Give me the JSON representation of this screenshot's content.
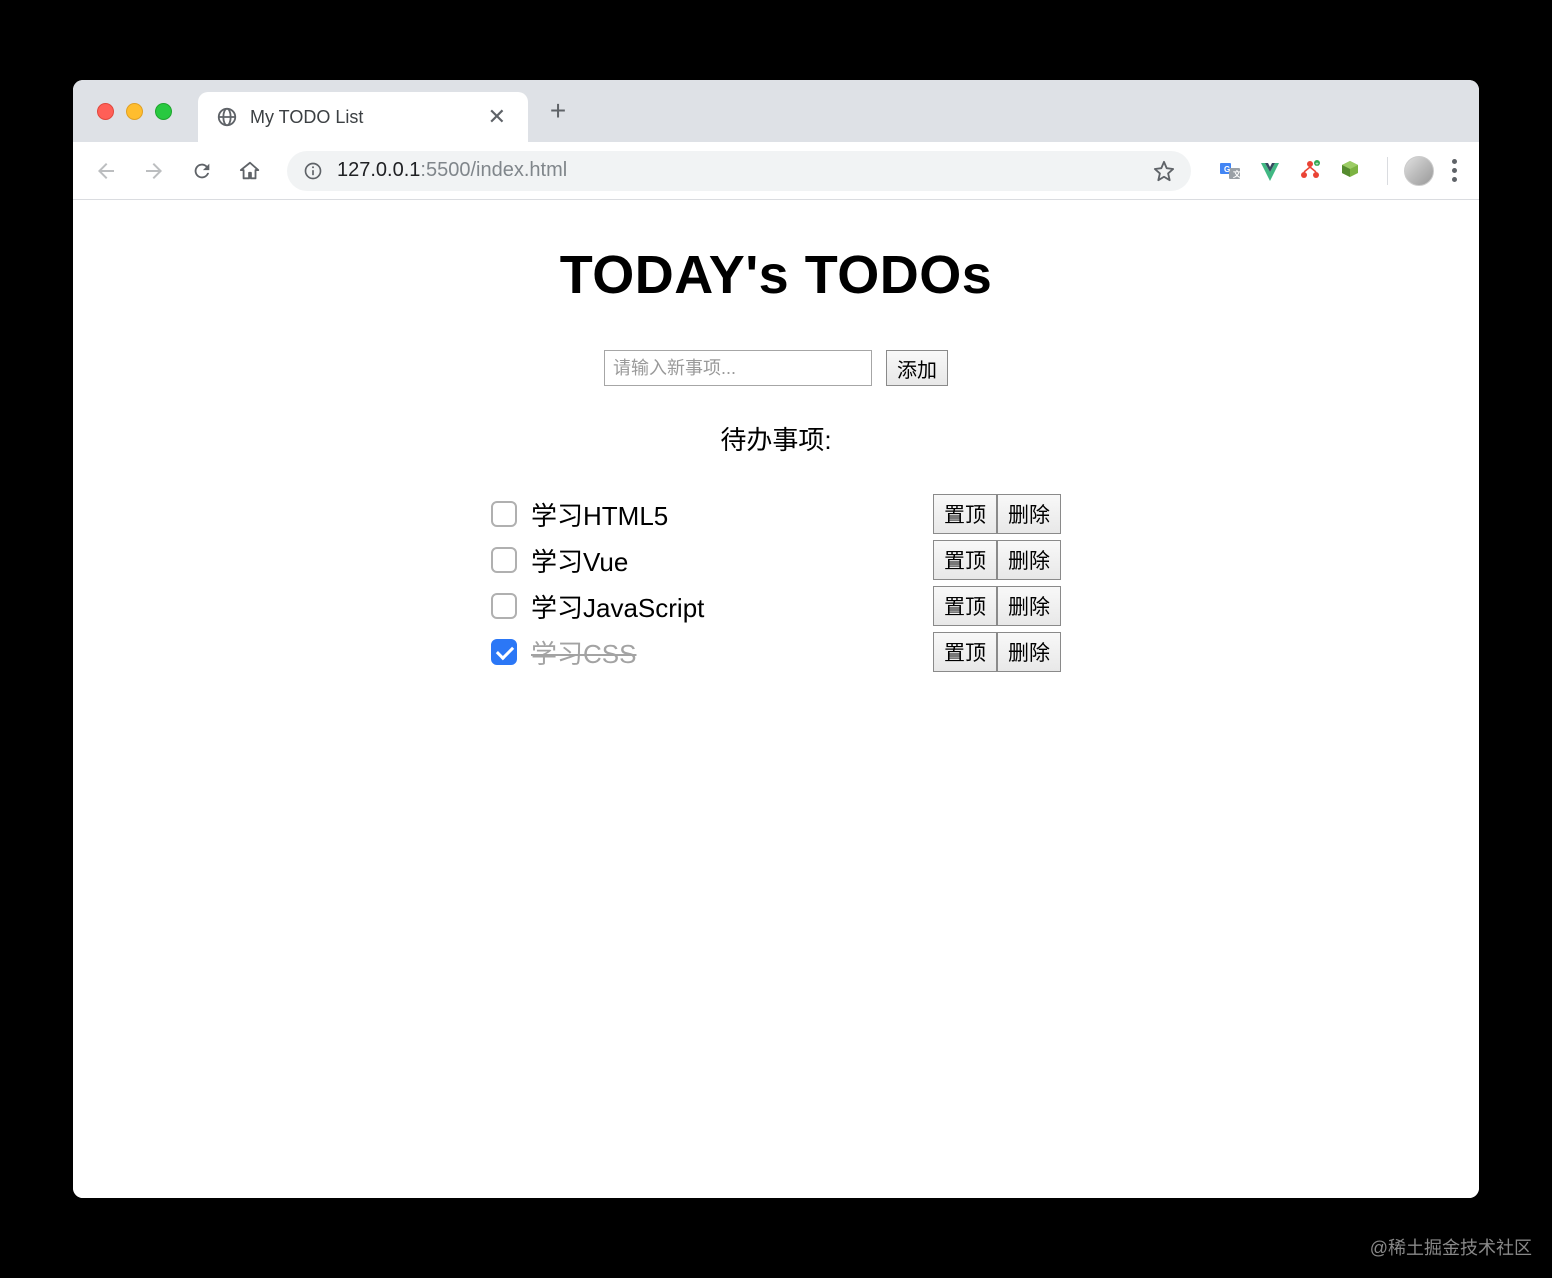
{
  "browser": {
    "tab_title": "My TODO List",
    "url_host": "127.0.0.1",
    "url_port_path": ":5500/index.html"
  },
  "page": {
    "heading": "TODAY's TODOs",
    "input_placeholder": "请输入新事项...",
    "add_button": "添加",
    "section_label": "待办事项:",
    "pin_label": "置顶",
    "delete_label": "删除",
    "todos": [
      {
        "text": "学习HTML5",
        "done": false
      },
      {
        "text": "学习Vue",
        "done": false
      },
      {
        "text": "学习JavaScript",
        "done": false
      },
      {
        "text": "学习CSS",
        "done": true
      }
    ]
  },
  "watermark": "@稀土掘金技术社区"
}
